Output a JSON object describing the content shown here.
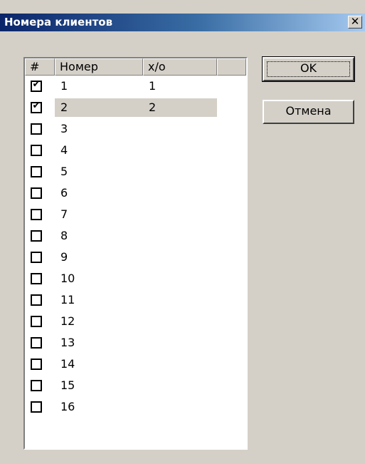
{
  "window": {
    "title": "Номера клиентов",
    "close_glyph": "✕"
  },
  "list": {
    "columns": [
      "#",
      "Номер",
      "х/о"
    ],
    "rows": [
      {
        "checked": true,
        "number": "1",
        "xo": "1"
      },
      {
        "checked": true,
        "number": "2",
        "xo": "2",
        "selected": true
      },
      {
        "checked": false,
        "number": "3",
        "xo": ""
      },
      {
        "checked": false,
        "number": "4",
        "xo": ""
      },
      {
        "checked": false,
        "number": "5",
        "xo": ""
      },
      {
        "checked": false,
        "number": "6",
        "xo": ""
      },
      {
        "checked": false,
        "number": "7",
        "xo": ""
      },
      {
        "checked": false,
        "number": "8",
        "xo": ""
      },
      {
        "checked": false,
        "number": "9",
        "xo": ""
      },
      {
        "checked": false,
        "number": "10",
        "xo": ""
      },
      {
        "checked": false,
        "number": "11",
        "xo": ""
      },
      {
        "checked": false,
        "number": "12",
        "xo": ""
      },
      {
        "checked": false,
        "number": "13",
        "xo": ""
      },
      {
        "checked": false,
        "number": "14",
        "xo": ""
      },
      {
        "checked": false,
        "number": "15",
        "xo": ""
      },
      {
        "checked": false,
        "number": "16",
        "xo": ""
      }
    ],
    "check_glyph": "✔"
  },
  "buttons": {
    "ok_label": "OK",
    "cancel_label": "Отмена"
  },
  "colors": {
    "face": "#d4d0c8",
    "title_start": "#0a246a",
    "title_end": "#a6caf0"
  }
}
